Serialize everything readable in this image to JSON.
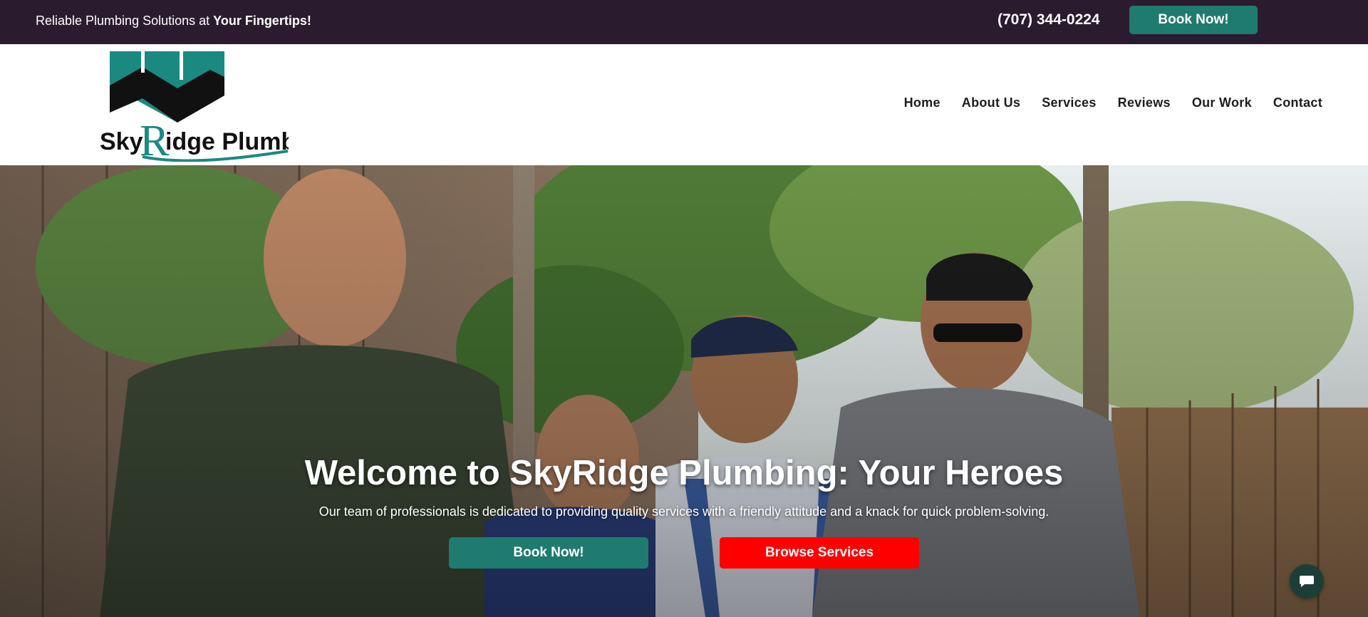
{
  "topbar": {
    "tagline_prefix": "Reliable Plumbing Solutions at ",
    "tagline_strong": "Your Fingertips!",
    "phone": "(707) 344-0224",
    "book_label": "Book Now!"
  },
  "logo": {
    "text": "SkyRidge Plumbing",
    "colors": {
      "teal": "#1a8a80",
      "dark": "#111111"
    }
  },
  "nav": {
    "items": [
      {
        "label": "Home"
      },
      {
        "label": "About Us"
      },
      {
        "label": "Services"
      },
      {
        "label": "Reviews"
      },
      {
        "label": "Our Work"
      },
      {
        "label": "Contact"
      }
    ]
  },
  "hero": {
    "title": "Welcome to SkyRidge Plumbing: Your Heroes",
    "subtitle": "Our team of professionals is dedicated to providing quality services with a friendly attitude and a knack for quick problem-solving.",
    "book_label": "Book Now!",
    "browse_label": "Browse Services"
  },
  "chat": {
    "icon": "chat-bubble-icon"
  },
  "colors": {
    "topbar_bg": "#2b1b2e",
    "accent_teal": "#1f7a6f",
    "accent_red": "#ff0000"
  }
}
